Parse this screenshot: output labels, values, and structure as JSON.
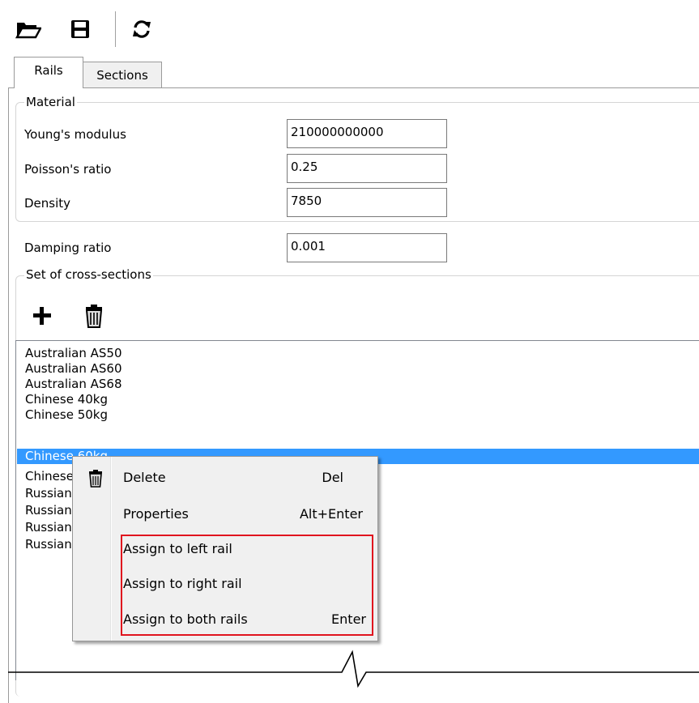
{
  "toolbar": {
    "icons": [
      "open-folder-icon",
      "save-icon",
      "refresh-icon"
    ]
  },
  "tabs": [
    {
      "label": "Rails",
      "active": true
    },
    {
      "label": "Sections",
      "active": false
    }
  ],
  "material": {
    "title": "Material",
    "youngs_label": "Young's modulus",
    "youngs_value": "210000000000",
    "poisson_label": "Poisson's ratio",
    "poisson_value": "0.25",
    "density_label": "Density",
    "density_value": "7850"
  },
  "damping": {
    "label": "Damping ratio",
    "value": "0.001"
  },
  "cross_sections": {
    "title": "Set of cross-sections",
    "items": [
      "Australian AS50",
      "Australian AS60",
      "Australian AS68",
      "Chinese 40kg",
      "Chinese 50kg",
      "Chinese 60kg",
      "Chinese 75kg",
      "Russian",
      "Russian",
      "Russian",
      "Russian"
    ],
    "selected_index": 5
  },
  "context_menu": {
    "delete_label": "Delete",
    "delete_shortcut": "Del",
    "properties_label": "Properties",
    "properties_shortcut": "Alt+Enter",
    "assign_left_label": "Assign to left rail",
    "assign_right_label": "Assign to right rail",
    "assign_both_label": "Assign to both rails",
    "assign_both_shortcut": "Enter",
    "highlight_color": "#e0141e"
  },
  "colors": {
    "selection": "#3399ff"
  }
}
